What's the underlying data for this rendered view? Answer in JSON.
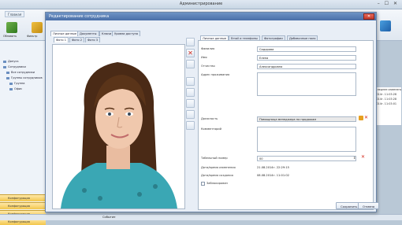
{
  "app": {
    "title": "Администрирование",
    "window_controls": "– ☐ ✕"
  },
  "ribbon": {
    "tab": "Главная",
    "button1": "Обновить",
    "button2": "Фильтр"
  },
  "left_panel": {
    "tree": [
      "Допуск",
      "Сотрудники",
      "Все сотрудники",
      "Группы сотрудников",
      "Группа",
      "Офис"
    ],
    "groups": [
      "Конфигурация",
      "Конфигурация",
      "Конфигурация",
      "Конфигурация"
    ]
  },
  "right_grid": {
    "header": "Последнее изменение",
    "rows": [
      "2.2014г. 11:03:28",
      "2.2014г. 11:03:28",
      "2.2014г. 11:03:01"
    ]
  },
  "status": {
    "text": "Событие"
  },
  "dialog": {
    "title": "Редактирование сотрудника",
    "top_tabs": [
      "Личные данные",
      "Документы",
      "Ключи",
      "Уровни доступа"
    ],
    "photo_tabs": [
      "Фото 1",
      "Фото 2",
      "Фото 3"
    ],
    "form_tabs": [
      "Личные данные",
      "Email и телефоны",
      "Фотографии",
      "Добавочные поля"
    ],
    "fields": {
      "last_name": {
        "label": "Фамилия",
        "value": "Сидорова"
      },
      "first_name": {
        "label": "Имя",
        "value": "Елена"
      },
      "middle_name": {
        "label": "Отчество",
        "value": "Александровна"
      },
      "address": {
        "label": "Адрес проживания",
        "value": ""
      },
      "position": {
        "label": "Должность",
        "value": "Помощница менеджера по продажам"
      },
      "comment": {
        "label": "Комментарий",
        "value": ""
      },
      "tab_number": {
        "label": "Табельный номер",
        "value": "00"
      },
      "change_date": {
        "label": "Дата/время изменения",
        "value": "21.08.2014г. 22:29:15"
      },
      "create_date": {
        "label": "Дата/время создания",
        "value": "08.08.2014г. 11:01:02"
      },
      "blocked": {
        "label": "Заблокирован"
      }
    },
    "buttons": {
      "save": "Сохранить",
      "cancel": "Отмена"
    }
  }
}
